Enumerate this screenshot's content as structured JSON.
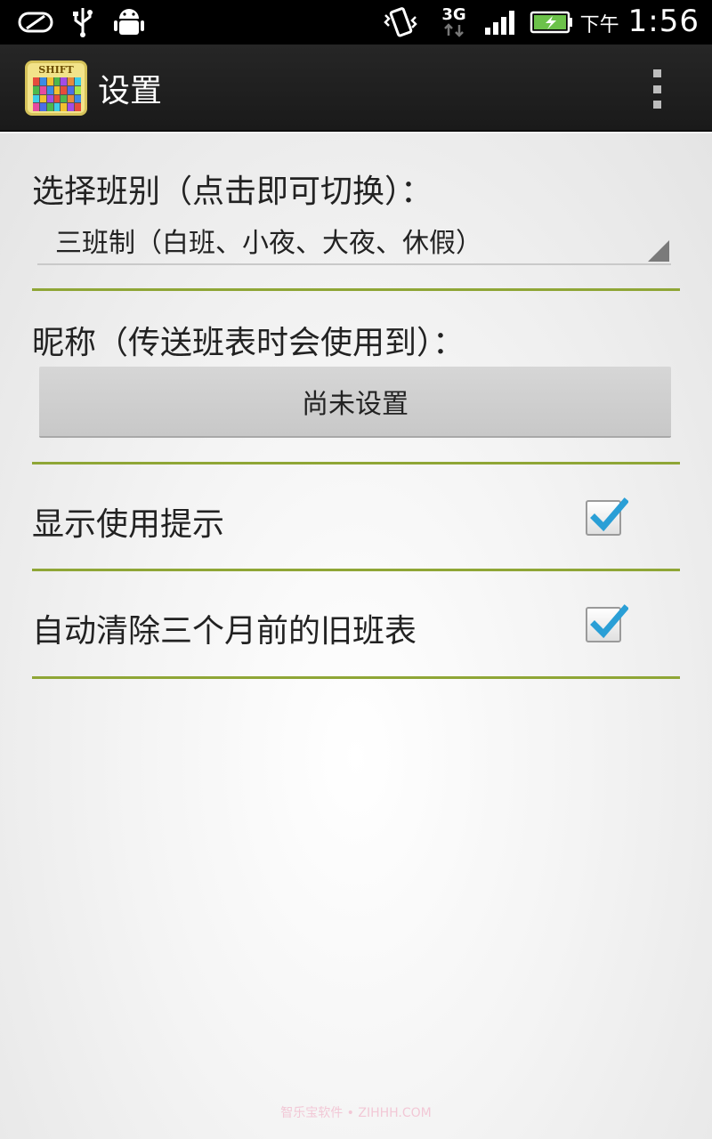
{
  "status_bar": {
    "ampm": "下午",
    "time": "1:56",
    "network": "3G",
    "icons": [
      "screen-off-icon",
      "usb-icon",
      "android-debug-icon",
      "vibrate-icon",
      "network-3g-icon",
      "signal-icon",
      "battery-charging-icon"
    ]
  },
  "action_bar": {
    "app_icon_label": "SHIFT",
    "title": "设置"
  },
  "prefs": {
    "shift_select_label": "选择班别（点击即可切换）：",
    "shift_select_value": "三班制（白班、小夜、大夜、休假）",
    "nickname_label": "昵称（传送班表时会使用到）：",
    "nickname_button": "尚未设置",
    "show_hints_label": "显示使用提示",
    "show_hints_checked": true,
    "auto_clear_label": "自动清除三个月前的旧班表",
    "auto_clear_checked": true
  },
  "colors": {
    "divider": "#8fa636",
    "check": "#2a9fd6"
  },
  "watermark": "智乐宝软件 • ZIHHH.COM"
}
